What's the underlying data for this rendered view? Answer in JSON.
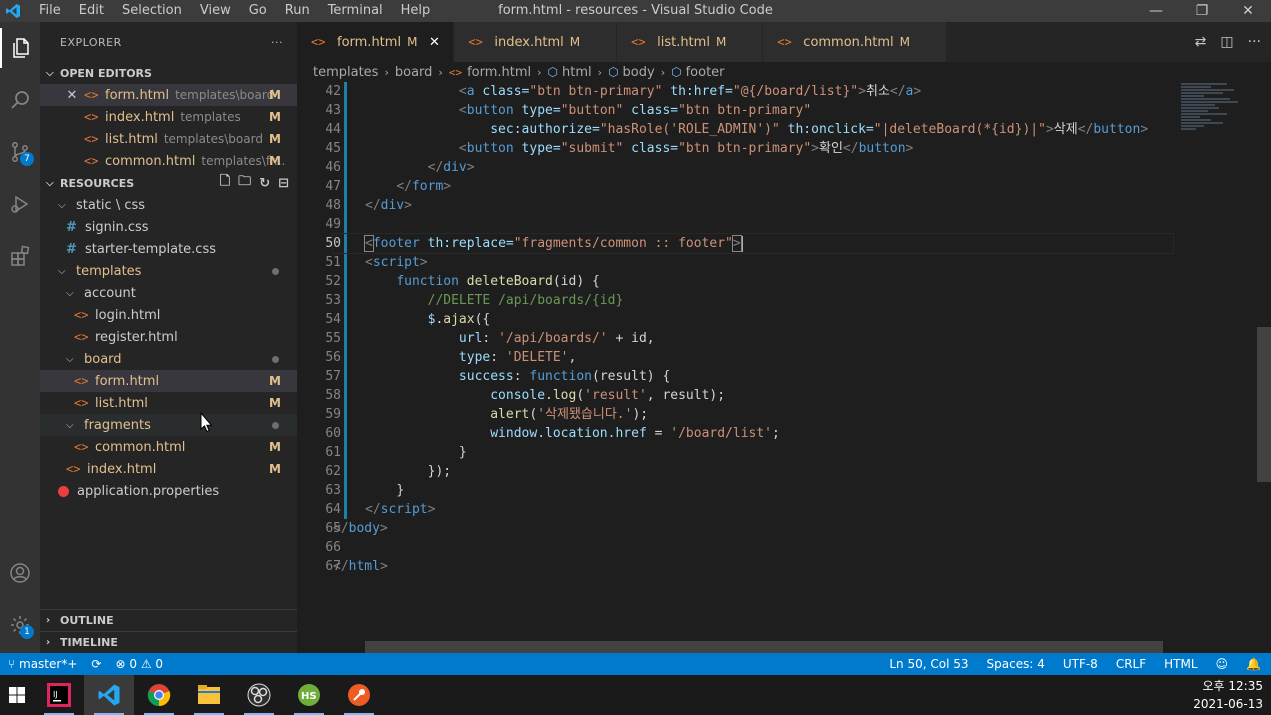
{
  "window": {
    "title": "form.html - resources - Visual Studio Code",
    "menu": [
      "File",
      "Edit",
      "Selection",
      "View",
      "Go",
      "Run",
      "Terminal",
      "Help"
    ],
    "controls": [
      "—",
      "❐",
      "✕"
    ]
  },
  "activity_bar": {
    "items": [
      "explorer-icon",
      "search-icon",
      "source-control-icon",
      "run-debug-icon",
      "extensions-icon"
    ],
    "scm_badge": "7",
    "bottom": [
      "account-icon",
      "settings-gear-icon"
    ],
    "settings_badge": "1"
  },
  "sidebar": {
    "title": "EXPLORER",
    "more": "···",
    "open_editors": {
      "title": "OPEN EDITORS",
      "items": [
        {
          "name": "form.html",
          "desc": "templates\\board",
          "flag": "M"
        },
        {
          "name": "index.html",
          "desc": "templates",
          "flag": "M"
        },
        {
          "name": "list.html",
          "desc": "templates\\board",
          "flag": "M"
        },
        {
          "name": "common.html",
          "desc": "templates\\fr...",
          "flag": "M"
        }
      ]
    },
    "resources": {
      "title": "RESOURCES",
      "static_css": "static \\ css",
      "signin": "signin.css",
      "starter": "starter-template.css",
      "templates": "templates",
      "account": "account",
      "login": "login.html",
      "register": "register.html",
      "board": "board",
      "form": "form.html",
      "list": "list.html",
      "fragments": "fragments",
      "common": "common.html",
      "index": "index.html",
      "app_props": "application.properties",
      "flag": "M"
    },
    "outline": "OUTLINE",
    "timeline": "TIMELINE"
  },
  "tabs": [
    {
      "name": "form.html",
      "flag": "M",
      "close": "✕"
    },
    {
      "name": "index.html",
      "flag": "M"
    },
    {
      "name": "list.html",
      "flag": "M"
    },
    {
      "name": "common.html",
      "flag": "M"
    }
  ],
  "breadcrumb": [
    "templates",
    "board",
    "form.html",
    "html",
    "body",
    "footer"
  ],
  "editor": {
    "line_numbers": [
      "42",
      "43",
      "44",
      "45",
      "46",
      "47",
      "48",
      "49",
      "50",
      "51",
      "52",
      "53",
      "54",
      "55",
      "56",
      "57",
      "58",
      "59",
      "60",
      "61",
      "62",
      "63",
      "64",
      "65",
      "66",
      "67"
    ],
    "current_line": "50",
    "lines": {
      "l42": {
        "attr_class": "class=",
        "class_val": "\"btn btn-primary\"",
        "attr_href": "th:href=",
        "href_val": "\"@{/board/list}\"",
        "text": "취소"
      },
      "l43": {
        "attr_type": "type=",
        "type_val": "\"button\"",
        "attr_class": "class=",
        "class_val": "\"btn btn-primary\""
      },
      "l44": {
        "attr_sec": "sec:authorize=",
        "sec_val": "\"hasRole('ROLE_ADMIN')\"",
        "attr_on": "th:onclick=",
        "on_val": "\"|deleteBoard(*{id})|\"",
        "text": "삭제"
      },
      "l45": {
        "attr_type": "type=",
        "type_val": "\"submit\"",
        "attr_class": "class=",
        "class_val": "\"btn btn-primary\"",
        "text": "확인"
      },
      "l50": {
        "attr": "th:replace=",
        "val": "\"fragments/common :: footer\""
      },
      "l52": {
        "kw": "function",
        "fn": "deleteBoard",
        "rest": "(id) {"
      },
      "l53": {
        "comment": "//DELETE /api/boards/{id}"
      },
      "l54": {
        "obj": "$",
        "fn": ".ajax",
        "rest": "({"
      },
      "l55": {
        "key": "url",
        "str": "'/api/boards/'",
        "rest": " + id,"
      },
      "l56": {
        "key": "type",
        "str": "'DELETE'",
        "rest": ","
      },
      "l57": {
        "key": "success",
        "kw": "function",
        "rest": "(result) {"
      },
      "l58": {
        "obj": "console",
        "fn": ".log",
        "str": "'result'",
        "rest": ", result);"
      },
      "l59": {
        "fn": "alert",
        "str": "'삭제됐습니다.'",
        "rest": ");"
      },
      "l60": {
        "obj": "window.location.href",
        "rest": " = ",
        "str": "'/board/list'",
        "end": ";"
      },
      "l61": {
        "rest": "}"
      },
      "l62": {
        "rest": "});"
      },
      "l63": {
        "rest": "}"
      }
    }
  },
  "status_bar": {
    "branch": "master*+",
    "sync": "⟳",
    "errors": "0",
    "warnings": "0",
    "position": "Ln 50, Col 53",
    "spaces": "Spaces: 4",
    "encoding": "UTF-8",
    "eol": "CRLF",
    "language": "HTML"
  },
  "taskbar": {
    "apps": [
      "windows-start-icon",
      "intellij-icon",
      "vscode-icon",
      "chrome-icon",
      "file-explorer-icon",
      "obs-icon",
      "heidisql-icon",
      "postman-icon"
    ],
    "clock_time": "오후 12:35",
    "clock_date": "2021-06-13"
  }
}
